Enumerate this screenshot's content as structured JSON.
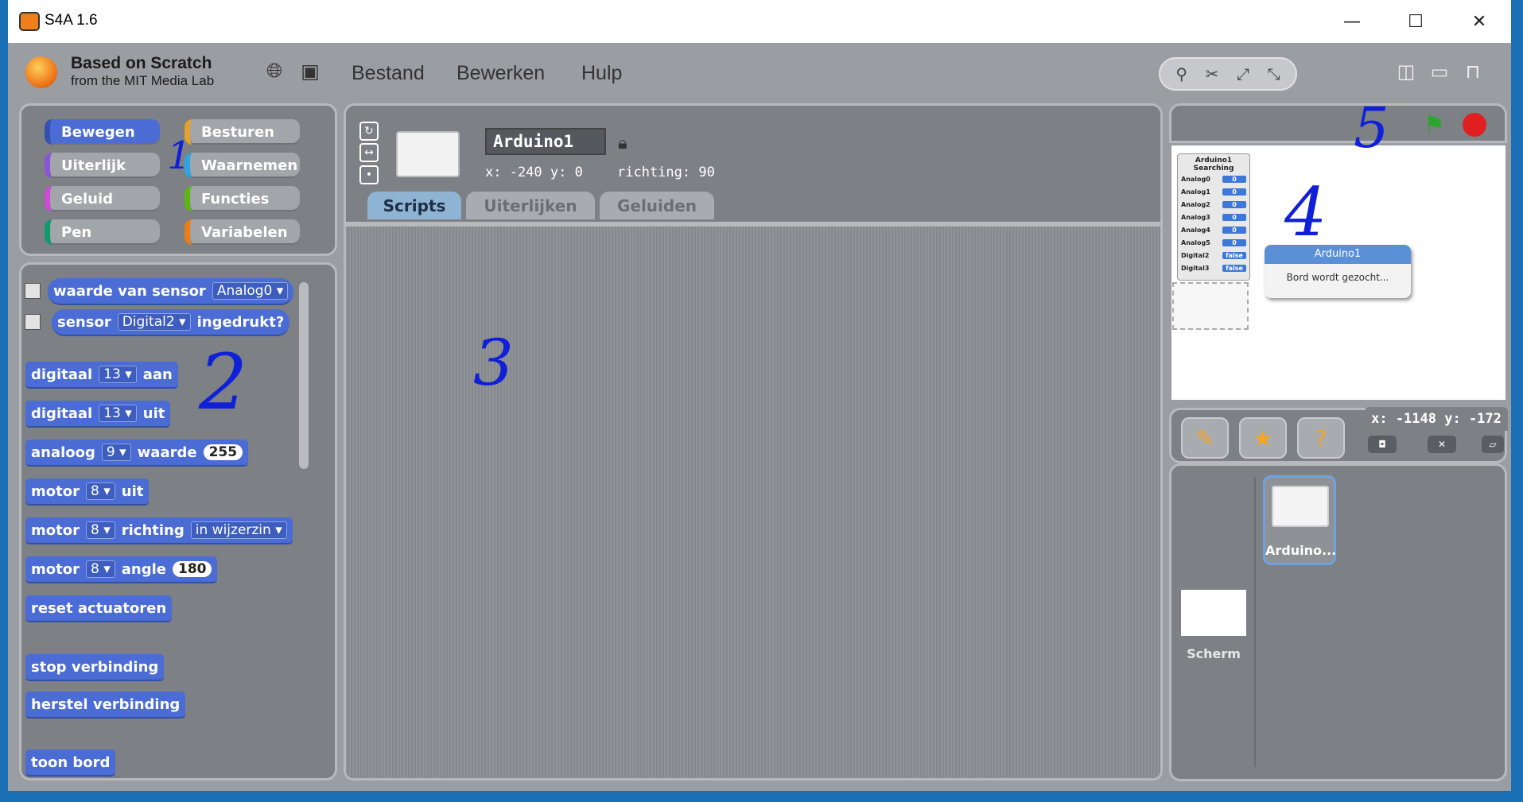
{
  "window": {
    "title": "S4A 1.6",
    "minimize": "—",
    "maximize": "☐",
    "close": "✕"
  },
  "menubar": {
    "logo_line1": "Based on Scratch",
    "logo_line2": "from the MIT Media Lab",
    "menus": [
      "Bestand",
      "Bewerken",
      "Hulp"
    ]
  },
  "categories": [
    {
      "label": "Bewegen",
      "color": "#4a6cd4"
    },
    {
      "label": "Besturen",
      "color": "#e6a12a"
    },
    {
      "label": "Uiterlijk",
      "color": "#8a55d7"
    },
    {
      "label": "Waarnemen",
      "color": "#2ca5e0"
    },
    {
      "label": "Geluid",
      "color": "#cf4ad9"
    },
    {
      "label": "Functies",
      "color": "#5cb712"
    },
    {
      "label": "Pen",
      "color": "#0e9a6c"
    },
    {
      "label": "Variabelen",
      "color": "#ee7d16"
    }
  ],
  "blocks": {
    "sensor_value": {
      "text": "waarde van sensor",
      "dropdown": "Analog0"
    },
    "sensor_pressed": {
      "pre": "sensor",
      "dropdown": "Digital2",
      "post": "ingedrukt?"
    },
    "digital_on": {
      "pre": "digitaal",
      "dropdown": "13",
      "post": "aan"
    },
    "digital_off": {
      "pre": "digitaal",
      "dropdown": "13",
      "post": "uit"
    },
    "analog": {
      "pre": "analoog",
      "dropdown": "9",
      "mid": "waarde",
      "value": "255"
    },
    "motor_off": {
      "pre": "motor",
      "dropdown": "8",
      "post": "uit"
    },
    "motor_dir": {
      "pre": "motor",
      "dropdown": "8",
      "mid": "richting",
      "dropdown2": "in wijzerzin"
    },
    "motor_angle": {
      "pre": "motor",
      "dropdown": "8",
      "mid": "angle",
      "value": "180"
    },
    "reset": "reset actuatoren",
    "stop": "stop verbinding",
    "restore": "herstel verbinding",
    "show_board": "toon bord"
  },
  "sprite": {
    "name": "Arduino1",
    "coords": "x: -240  y: 0",
    "direction": "richting: 90"
  },
  "tabs": [
    "Scripts",
    "Uiterlijken",
    "Geluiden"
  ],
  "stage": {
    "watcher_title": "Arduino1 Searching",
    "watcher_rows": [
      {
        "label": "Analog0",
        "value": "0"
      },
      {
        "label": "Analog1",
        "value": "0"
      },
      {
        "label": "Analog2",
        "value": "0"
      },
      {
        "label": "Analog3",
        "value": "0"
      },
      {
        "label": "Analog4",
        "value": "0"
      },
      {
        "label": "Analog5",
        "value": "0"
      },
      {
        "label": "Digital2",
        "value": "false"
      },
      {
        "label": "Digital3",
        "value": "false"
      }
    ],
    "dialog_title": "Arduino1",
    "dialog_text": "Bord wordt gezocht...",
    "mouse_coords": "x: -1148  y: -172"
  },
  "sprites_area": {
    "sprite_label": "Arduino...",
    "stage_label": "Scherm"
  },
  "annotations": [
    "1",
    "2",
    "3",
    "4",
    "5"
  ]
}
